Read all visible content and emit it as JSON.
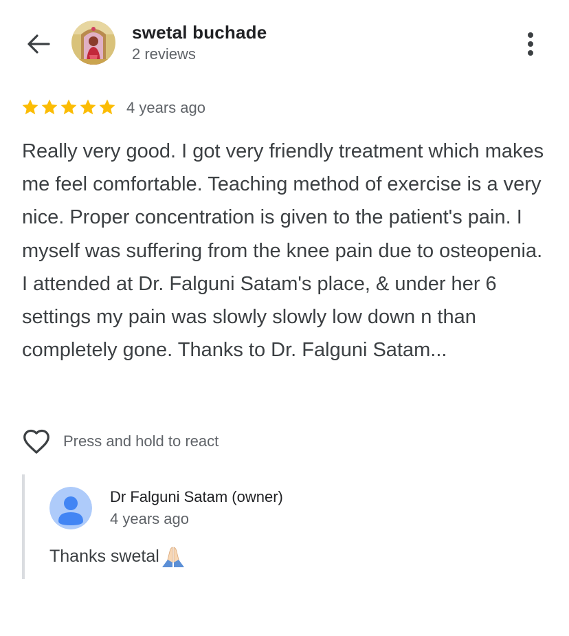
{
  "header": {
    "back_icon": "arrow-left-icon",
    "reviewer_name": "swetal buchade",
    "reviewer_reviews": "2 reviews",
    "avatar_icon": "profile-photo",
    "more_icon": "more-vertical-icon"
  },
  "review": {
    "rating": 5,
    "rating_max": 5,
    "star_color": "#fbbc04",
    "time": "4 years ago",
    "text": "Really very good. I got very friendly treatment which makes me feel comfortable. Teaching method of exercise is a very nice. Proper concentration is given to the patient's pain. I myself was suffering from the knee pain due to osteopenia. I attended at Dr. Falguni Satam's place, & under her 6 settings my pain was slowly slowly low down n than completely gone. Thanks to Dr. Falguni Satam..."
  },
  "react": {
    "icon": "heart-outline-icon",
    "label": "Press and hold to react"
  },
  "owner_reply": {
    "avatar_icon": "default-person-avatar-icon",
    "name": "Dr Falguni Satam (owner)",
    "time": "4 years ago",
    "text": "Thanks swetal",
    "emoji_icon": "folded-hands-icon"
  },
  "colors": {
    "primary_text": "#202124",
    "secondary_text": "#5f6368",
    "body_text": "#3c4043",
    "star": "#fbbc04",
    "owner_avatar_bg": "#aecbfa",
    "owner_avatar_fg": "#4285f4",
    "reply_border": "#dadce0"
  }
}
